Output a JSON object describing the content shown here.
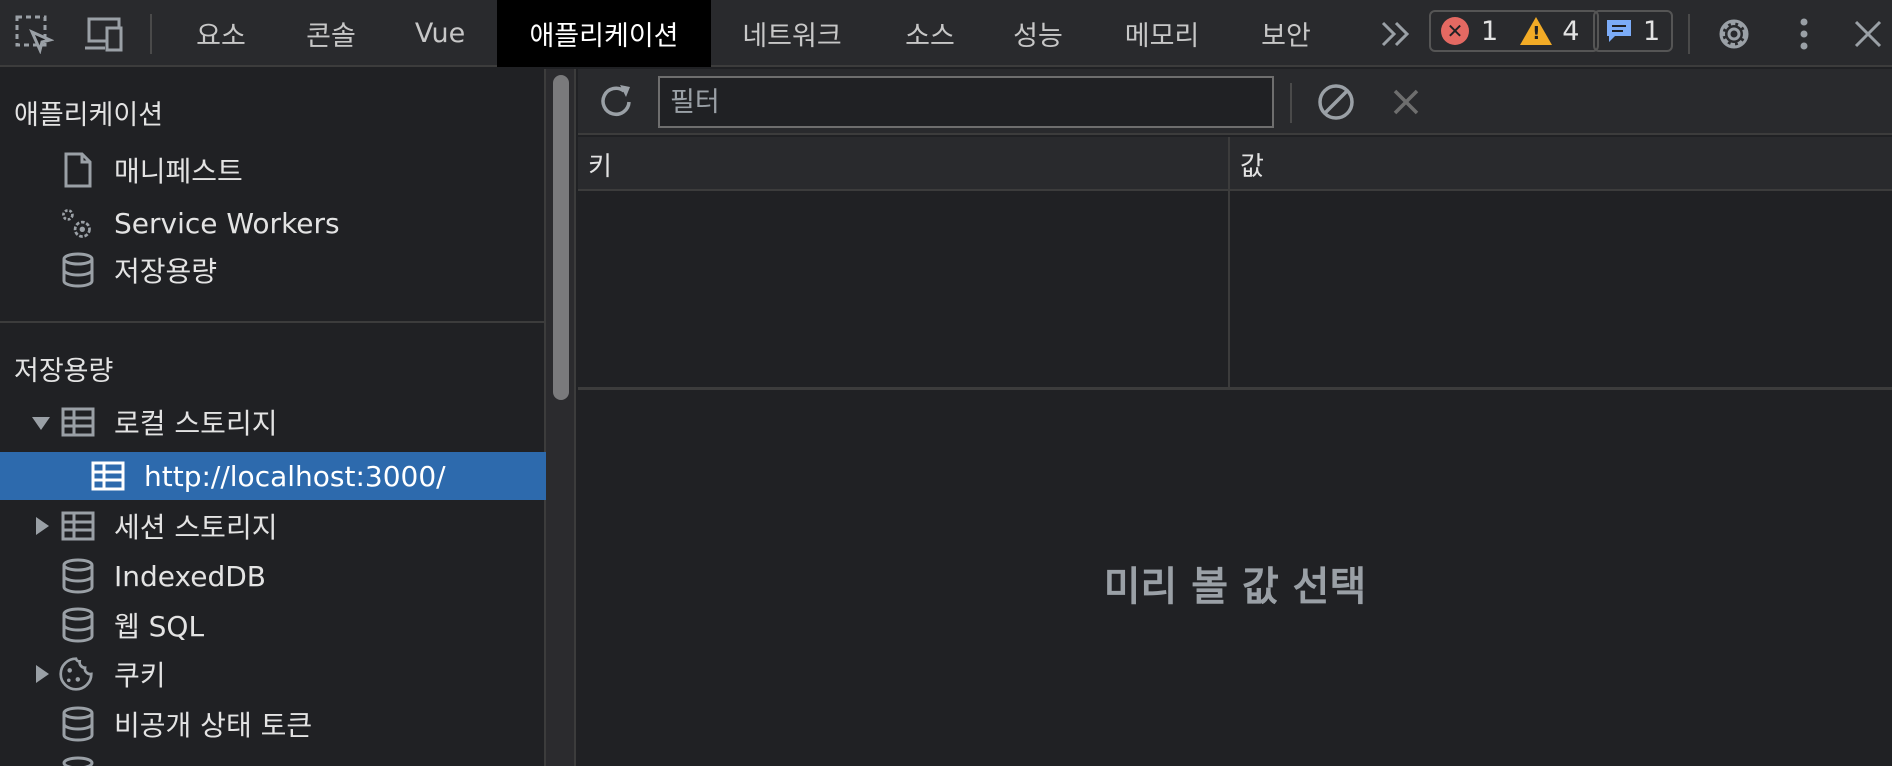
{
  "toolbar": {
    "tabs": [
      {
        "label": "요소"
      },
      {
        "label": "콘솔"
      },
      {
        "label": "Vue"
      },
      {
        "label": "애플리케이션",
        "active": true
      },
      {
        "label": "네트워크"
      },
      {
        "label": "소스"
      },
      {
        "label": "성능"
      },
      {
        "label": "메모리"
      },
      {
        "label": "보안"
      }
    ],
    "more_tabs_icon": "chevron-double-right-icon",
    "errors_count": "1",
    "warnings_count": "4",
    "messages_count": "1",
    "colors": {
      "error": "#e46962",
      "warning": "#f2ab26",
      "message": "#7cacf8",
      "active_tab_bg": "#000000"
    }
  },
  "sidebar": {
    "app_section_title": "애플리케이션",
    "app_items": [
      {
        "label": "매니페스트",
        "icon": "file-icon"
      },
      {
        "label": "Service Workers",
        "icon": "gears-icon"
      },
      {
        "label": "저장용량",
        "icon": "database-icon"
      }
    ],
    "storage_section_title": "저장용량",
    "storage_items": [
      {
        "label": "로컬 스토리지",
        "icon": "table-icon",
        "expanded": true
      },
      {
        "label": "http://localhost:3000/",
        "icon": "table-icon",
        "selected": true
      },
      {
        "label": "세션 스토리지",
        "icon": "table-icon",
        "expanded": false
      },
      {
        "label": "IndexedDB",
        "icon": "database-icon"
      },
      {
        "label": "웹 SQL",
        "icon": "database-icon"
      },
      {
        "label": "쿠키",
        "icon": "cookie-icon",
        "expanded": false
      },
      {
        "label": "비공개 상태 토큰",
        "icon": "database-icon"
      }
    ],
    "selected_color": "#2d6aad"
  },
  "main": {
    "filter_placeholder": "필터",
    "columns": {
      "key": "키",
      "value": "값"
    },
    "preview_placeholder": "미리 볼 값 선택"
  }
}
